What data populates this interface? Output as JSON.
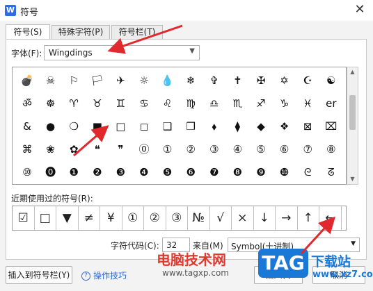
{
  "window": {
    "app_icon": "W",
    "title": "符号",
    "close": "✕"
  },
  "tabs": [
    {
      "label": "符号(S)",
      "active": true
    },
    {
      "label": "特殊字符(P)",
      "active": false
    },
    {
      "label": "符号栏(T)",
      "active": false
    }
  ],
  "font": {
    "label": "字体(F):",
    "value": "Wingdings"
  },
  "symbol_grid": {
    "rows": [
      [
        "💣",
        "☠",
        "⚐",
        "🏳",
        "✈",
        "☼",
        "💧",
        "❄",
        "✞",
        "✝",
        "✠",
        "✡",
        "☪",
        "☯"
      ],
      [
        "ॐ",
        "☸",
        "♈",
        "♉",
        "♊",
        "♋",
        "♌",
        "♍",
        "♎",
        "♏",
        "♐",
        "♑",
        "♓",
        "er"
      ],
      [
        "&",
        "●",
        "❍",
        "■",
        "□",
        "◻",
        "❑",
        "❒",
        "⬧",
        "⧫",
        "◆",
        "❖",
        "⊠",
        "⌧"
      ],
      [
        "⌘",
        "❀",
        "✿",
        "❝",
        "❞",
        "⓪",
        "①",
        "②",
        "③",
        "④",
        "⑤",
        "⑥",
        "⑦",
        "⑧"
      ],
      [
        "⑩",
        "⓿",
        "❶",
        "❷",
        "❸",
        "❹",
        "❺",
        "❻",
        "❼",
        "❽",
        "❾",
        "❿",
        "ᘓ",
        "ᘔ"
      ]
    ]
  },
  "recent": {
    "label": "近期使用过的符号(R):",
    "symbols": [
      "☑",
      "□",
      "▼",
      "≠",
      "¥",
      "①",
      "②",
      "③",
      "№",
      "√",
      "×",
      "↓",
      "→",
      "↑",
      "←"
    ]
  },
  "code": {
    "label": "字符代码(C):",
    "value": "32"
  },
  "from": {
    "label": "来自(M)",
    "value": "Symbol(十进制)"
  },
  "buttons": {
    "insert_to_bar": "插入到符号栏(Y)",
    "tips": "操作技巧",
    "insert": "插入(I)",
    "cancel": "取消"
  },
  "watermark": {
    "site_cn": "电脑技术网",
    "url": "www.tagxp.com",
    "tag": "TAG",
    "dl": "下载站",
    "dl_url": "www.xz7.com"
  },
  "colors": {
    "accent": "#2b6de8",
    "arrow": "#e0282d",
    "watermark_red": "#e03a2f",
    "watermark_blue": "#1a78d6"
  }
}
